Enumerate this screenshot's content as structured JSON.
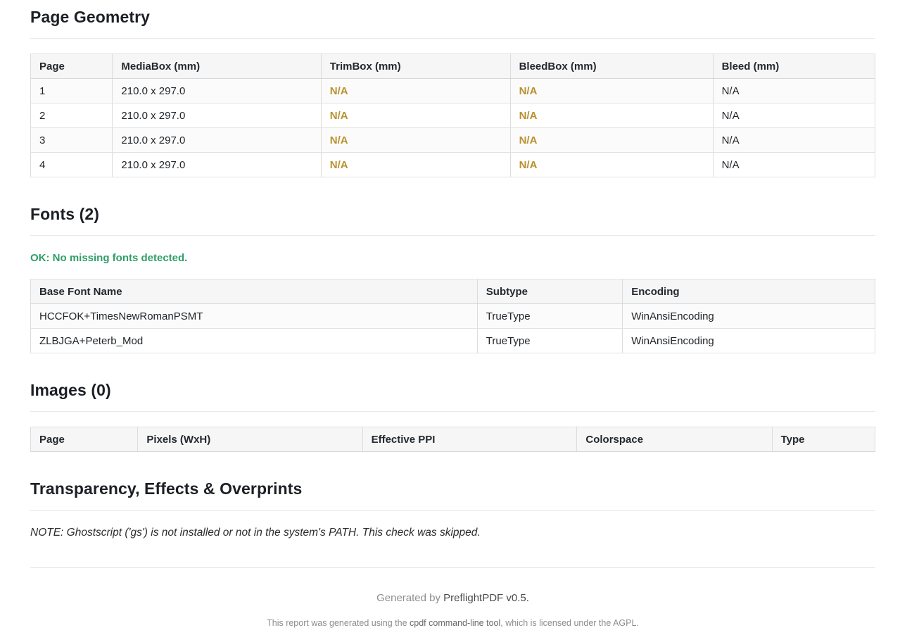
{
  "sections": {
    "geometry": {
      "title": "Page Geometry",
      "table": {
        "headers": [
          "Page",
          "MediaBox (mm)",
          "TrimBox (mm)",
          "BleedBox (mm)",
          "Bleed (mm)"
        ],
        "rows": [
          [
            "1",
            "210.0 x 297.0",
            "N/A",
            "N/A",
            "N/A"
          ],
          [
            "2",
            "210.0 x 297.0",
            "N/A",
            "N/A",
            "N/A"
          ],
          [
            "3",
            "210.0 x 297.0",
            "N/A",
            "N/A",
            "N/A"
          ],
          [
            "4",
            "210.0 x 297.0",
            "N/A",
            "N/A",
            "N/A"
          ]
        ],
        "warn_cols": [
          2,
          3
        ]
      }
    },
    "fonts": {
      "title": "Fonts (2)",
      "status_ok": "OK: No missing fonts detected.",
      "table": {
        "headers": [
          "Base Font Name",
          "Subtype",
          "Encoding"
        ],
        "rows": [
          [
            "HCCFOK+TimesNewRomanPSMT",
            "TrueType",
            "WinAnsiEncoding"
          ],
          [
            "ZLBJGA+Peterb_Mod",
            "TrueType",
            "WinAnsiEncoding"
          ]
        ],
        "warn_cols": []
      }
    },
    "images": {
      "title": "Images (0)",
      "table": {
        "headers": [
          "Page",
          "Pixels (WxH)",
          "Effective PPI",
          "Colorspace",
          "Type"
        ],
        "rows": [],
        "warn_cols": []
      }
    },
    "transparency": {
      "title": "Transparency, Effects & Overprints",
      "note": "NOTE: Ghostscript ('gs') is not installed or not in the system's PATH. This check was skipped."
    }
  },
  "footer": {
    "generated_prefix": "Generated by ",
    "generator_name": "PreflightPDF v0.5.",
    "license_before": "This report was generated using the ",
    "license_tool": "cpdf command-line tool",
    "license_after": ", which is licensed under the AGPL."
  },
  "colors": {
    "warning_gold": "#b9912d",
    "success_green": "#2f9e68"
  }
}
